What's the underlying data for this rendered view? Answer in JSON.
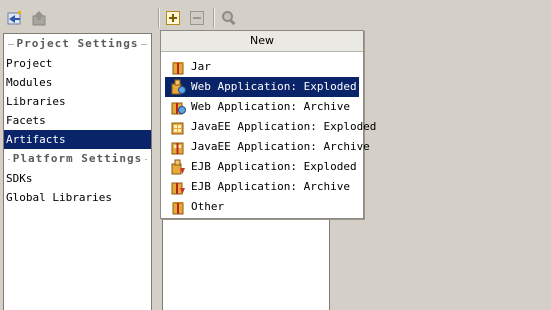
{
  "toolbar": {
    "back_icon": "back-arrow-icon",
    "up_icon": "up-folder-icon",
    "add_icon": "add-icon",
    "remove_icon": "remove-icon",
    "search_icon": "magnifier-icon"
  },
  "sidebar": {
    "project_settings_header": "Project Settings",
    "project_items": [
      {
        "label": "Project"
      },
      {
        "label": "Modules"
      },
      {
        "label": "Libraries"
      },
      {
        "label": "Facets"
      },
      {
        "label": "Artifacts",
        "selected": true
      }
    ],
    "platform_settings_header": "Platform Settings",
    "platform_items": [
      {
        "label": "SDKs"
      },
      {
        "label": "Global Libraries"
      }
    ]
  },
  "popup": {
    "title": "New",
    "items": [
      {
        "label": "Jar",
        "icon": "jar-icon"
      },
      {
        "label": "Web Application: Exploded",
        "icon": "web-app-exploded-icon",
        "selected": true
      },
      {
        "label": "Web Application: Archive",
        "icon": "web-app-archive-icon"
      },
      {
        "label": "JavaEE Application: Exploded",
        "icon": "javaee-exploded-icon"
      },
      {
        "label": "JavaEE Application: Archive",
        "icon": "javaee-archive-icon"
      },
      {
        "label": "EJB Application: Exploded",
        "icon": "ejb-exploded-icon"
      },
      {
        "label": "EJB Application: Archive",
        "icon": "ejb-archive-icon"
      },
      {
        "label": "Other",
        "icon": "other-artifact-icon"
      }
    ]
  },
  "colors": {
    "background": "#d4d0c8",
    "selection": "#0a246a"
  }
}
